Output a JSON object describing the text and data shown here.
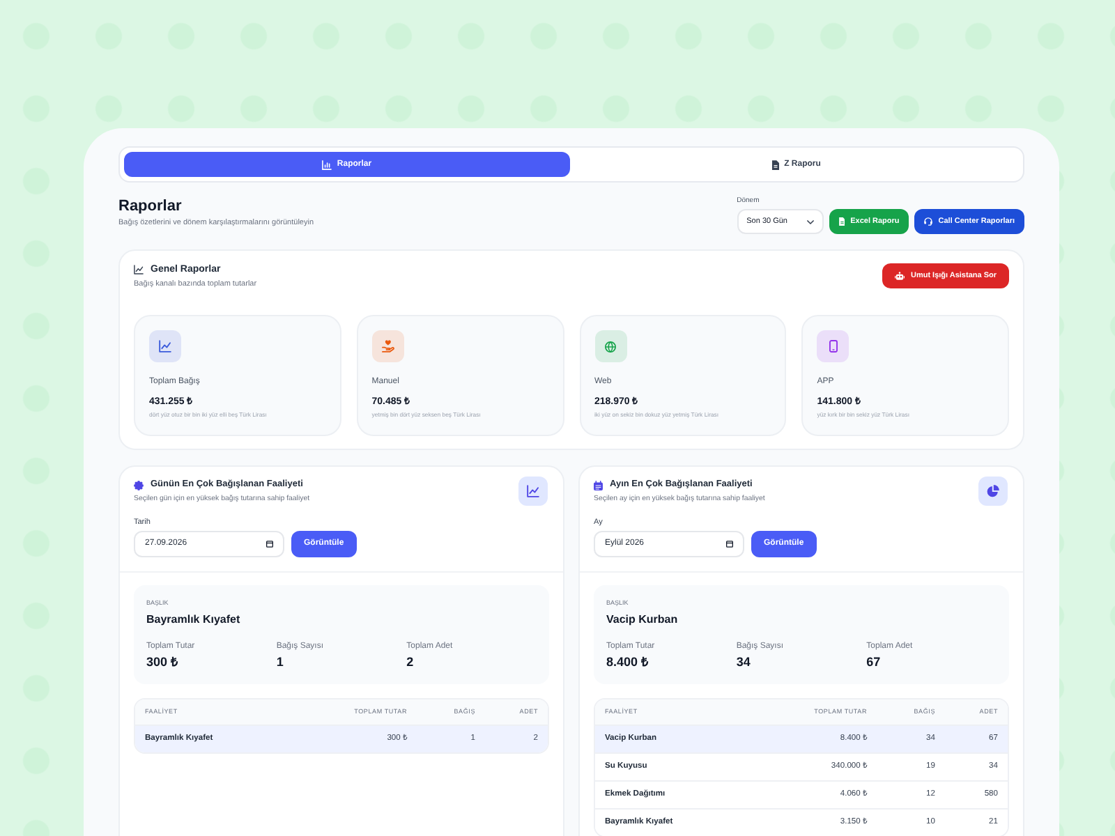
{
  "tabs": [
    {
      "label": "Raporlar",
      "selected": true
    },
    {
      "label": "Z Raporu",
      "selected": false
    }
  ],
  "header": {
    "title": "Raporlar",
    "subtitle": "Bağış özetlerini ve dönem karşılaştırmalarını görüntüleyin",
    "period": {
      "label": "Dönem",
      "value": "Son 30 Gün"
    },
    "buttons": [
      {
        "kind": "excel",
        "label": "Excel Raporu"
      },
      {
        "kind": "call_center",
        "label": "Call Center Raporları"
      }
    ]
  },
  "general_reports": {
    "title": "Genel Raporlar",
    "subtitle": "Bağış kanalı bazında toplam tutarlar",
    "assistant_button": "Umut Işığı Asistana Sor",
    "stats": [
      {
        "kind": "total",
        "label": "Toplam Bağış",
        "value": "431.255 ₺",
        "in_words": "dört yüz otuz bir bin iki yüz elli beş Türk Lirası",
        "color": "#3b5bdb"
      },
      {
        "kind": "manual",
        "label": "Manuel",
        "value": "70.485 ₺",
        "in_words": "yetmiş bin dört yüz seksen beş Türk Lirası",
        "color": "#ea580c"
      },
      {
        "kind": "web",
        "label": "Web",
        "value": "218.970 ₺",
        "in_words": "iki yüz on sekiz bin dokuz yüz yetmiş Türk Lirası",
        "color": "#16a34a"
      },
      {
        "kind": "app",
        "label": "APP",
        "value": "141.800 ₺",
        "in_words": "yüz kırk bir bin sekiz yüz Türk Lirası",
        "color": "#9333ea"
      }
    ]
  },
  "panels": [
    {
      "kind": "day",
      "title": "Günün En Çok Bağışlanan Faaliyeti",
      "subtitle": "Seçilen gün için en yüksek bağış tutarına sahip faaliyet",
      "field_label": "Tarih",
      "field_value": "27.09.2026",
      "button": "Görüntüle",
      "summary": {
        "label": "BAŞLIK",
        "name": "Bayramlık Kıyafet",
        "metrics": [
          {
            "label": "Toplam Tutar",
            "value": "300 ₺"
          },
          {
            "label": "Bağış Sayısı",
            "value": "1"
          },
          {
            "label": "Toplam Adet",
            "value": "2"
          }
        ]
      },
      "table": {
        "columns": [
          "FAALİYET",
          "TOPLAM TUTAR",
          "BAĞIŞ",
          "ADET"
        ],
        "rows": [
          {
            "selected": true,
            "cells": [
              "Bayramlık Kıyafet",
              "300 ₺",
              "1",
              "2"
            ]
          }
        ]
      }
    },
    {
      "kind": "month",
      "title": "Ayın En Çok Bağışlanan Faaliyeti",
      "subtitle": "Seçilen ay için en yüksek bağış tutarına sahip faaliyet",
      "field_label": "Ay",
      "field_value": "Eylül 2026",
      "button": "Görüntüle",
      "summary": {
        "label": "BAŞLIK",
        "name": "Vacip Kurban",
        "metrics": [
          {
            "label": "Toplam Tutar",
            "value": "8.400 ₺"
          },
          {
            "label": "Bağış Sayısı",
            "value": "34"
          },
          {
            "label": "Toplam Adet",
            "value": "67"
          }
        ]
      },
      "table": {
        "columns": [
          "FAALİYET",
          "TOPLAM TUTAR",
          "BAĞIŞ",
          "ADET"
        ],
        "rows": [
          {
            "selected": true,
            "cells": [
              "Vacip Kurban",
              "8.400 ₺",
              "34",
              "67"
            ]
          },
          {
            "selected": false,
            "cells": [
              "Su Kuyusu",
              "340.000 ₺",
              "19",
              "34"
            ]
          },
          {
            "selected": false,
            "cells": [
              "Ekmek Dağıtımı",
              "4.060 ₺",
              "12",
              "580"
            ]
          },
          {
            "selected": false,
            "cells": [
              "Bayramlık Kıyafet",
              "3.150 ₺",
              "10",
              "21"
            ]
          }
        ]
      }
    }
  ]
}
